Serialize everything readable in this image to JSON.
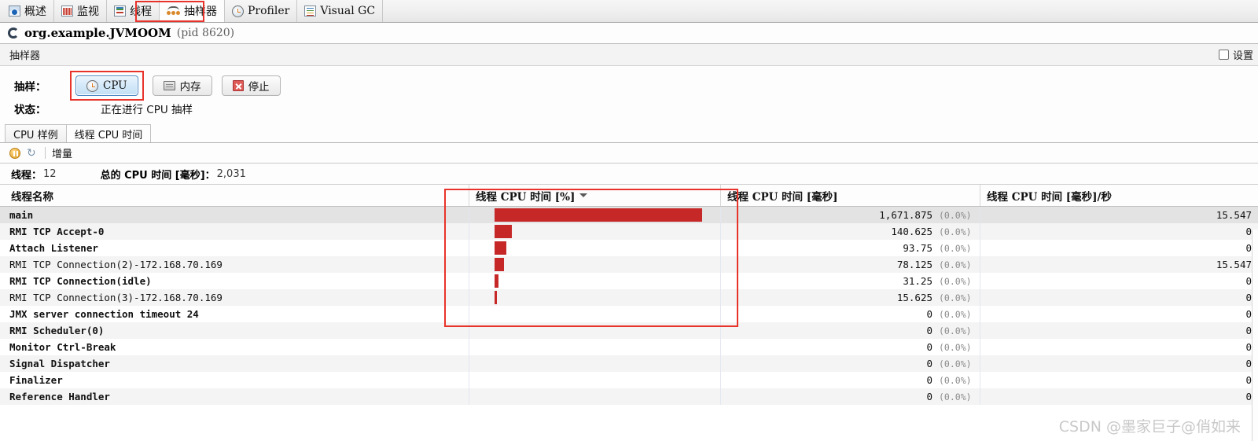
{
  "app_tabs": [
    {
      "label": "概述",
      "icon": "overview-icon",
      "selected": false
    },
    {
      "label": "监视",
      "icon": "monitor-icon",
      "selected": false
    },
    {
      "label": "线程",
      "icon": "threads-icon",
      "selected": false
    },
    {
      "label": "抽样器",
      "icon": "sampler-icon",
      "selected": true
    },
    {
      "label": "Profiler",
      "icon": "clock-icon",
      "selected": false
    },
    {
      "label": "Visual GC",
      "icon": "visualgc-icon",
      "selected": false
    }
  ],
  "process": {
    "name": "org.example.JVMOOM",
    "pid": "(pid 8620)",
    "icon": "process-spinner-icon"
  },
  "panel": {
    "title": "抽样器",
    "settings_label": "设置",
    "settings_checked": false
  },
  "controls": {
    "sample_label": "抽样：",
    "cpu_button": "CPU",
    "memory_button": "内存",
    "stop_button": "停止",
    "status_label": "状态：",
    "status_value": "正在进行 CPU 抽样",
    "highlight_color": "#e8332a"
  },
  "inner_tabs": [
    {
      "label": "CPU 样例",
      "active": false
    },
    {
      "label": "线程 CPU 时间",
      "active": true
    }
  ],
  "mini_toolbar": {
    "pause_icon": "pause-icon",
    "refresh_icon": "refresh-icon",
    "delta_label": "增量"
  },
  "summary": {
    "threads_key": "线程：",
    "threads_value": "12",
    "total_key": "总的 CPU 时间 [毫秒]：",
    "total_value": "2,031"
  },
  "table": {
    "columns": [
      "线程名称",
      "线程 CPU 时间 [%]",
      "线程 CPU 时间 [毫秒]",
      "线程 CPU 时间 [毫秒]/秒"
    ],
    "sorted_column_index": 1,
    "sort_direction": "desc",
    "bar_color": "#c62828",
    "max_bar_value": 1671.875,
    "rows": [
      {
        "name": "main",
        "bold": true,
        "bar": 1671.875,
        "ms": "1,671.875",
        "pct": "(0.0%)",
        "ms_per_sec": "15.547",
        "selected": true
      },
      {
        "name": "RMI TCP Accept-0",
        "bold": true,
        "bar": 140.625,
        "ms": "140.625",
        "pct": "(0.0%)",
        "ms_per_sec": "0",
        "selected": false
      },
      {
        "name": "Attach Listener",
        "bold": true,
        "bar": 93.75,
        "ms": "93.75",
        "pct": "(0.0%)",
        "ms_per_sec": "0",
        "selected": false
      },
      {
        "name": "RMI TCP Connection(2)-172.168.70.169",
        "bold": false,
        "bar": 78.125,
        "ms": "78.125",
        "pct": "(0.0%)",
        "ms_per_sec": "15.547",
        "selected": false
      },
      {
        "name": "RMI TCP Connection(idle)",
        "bold": true,
        "bar": 31.25,
        "ms": "31.25",
        "pct": "(0.0%)",
        "ms_per_sec": "0",
        "selected": false
      },
      {
        "name": "RMI TCP Connection(3)-172.168.70.169",
        "bold": false,
        "bar": 15.625,
        "ms": "15.625",
        "pct": "(0.0%)",
        "ms_per_sec": "0",
        "selected": false
      },
      {
        "name": "JMX server connection timeout 24",
        "bold": true,
        "bar": 0,
        "ms": "0",
        "pct": "(0.0%)",
        "ms_per_sec": "0",
        "selected": false
      },
      {
        "name": "RMI Scheduler(0)",
        "bold": true,
        "bar": 0,
        "ms": "0",
        "pct": "(0.0%)",
        "ms_per_sec": "0",
        "selected": false
      },
      {
        "name": "Monitor Ctrl-Break",
        "bold": true,
        "bar": 0,
        "ms": "0",
        "pct": "(0.0%)",
        "ms_per_sec": "0",
        "selected": false
      },
      {
        "name": "Signal Dispatcher",
        "bold": true,
        "bar": 0,
        "ms": "0",
        "pct": "(0.0%)",
        "ms_per_sec": "0",
        "selected": false
      },
      {
        "name": "Finalizer",
        "bold": true,
        "bar": 0,
        "ms": "0",
        "pct": "(0.0%)",
        "ms_per_sec": "0",
        "selected": false
      },
      {
        "name": "Reference Handler",
        "bold": true,
        "bar": 0,
        "ms": "0",
        "pct": "(0.0%)",
        "ms_per_sec": "0",
        "selected": false
      }
    ]
  },
  "watermark": "CSDN @墨家巨子@俏如来"
}
